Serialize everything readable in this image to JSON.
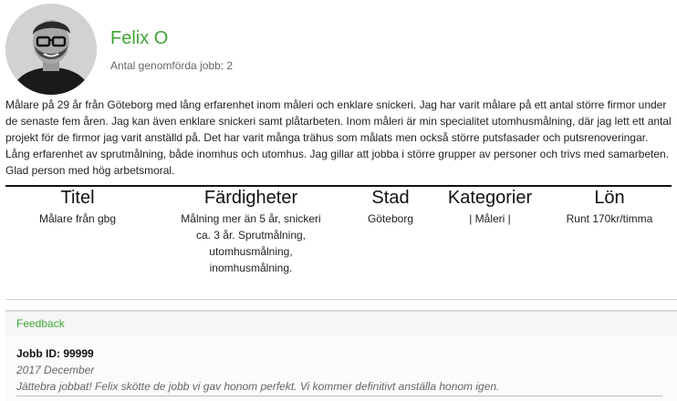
{
  "profile": {
    "name": "Felix O",
    "jobs_label": "Antal genomförda jobb: 2",
    "bio": "Målare på 29 år från Göteborg med lång erfarenhet inom måleri och enklare snickeri. Jag har varit målare på ett antal större firmor under de senaste fem åren. Jag kan även enklare snickeri samt plåtarbeten. Inom måleri är min specialitet utomhusmålning, där jag lett ett antal projekt för de firmor jag varit anställd på. Det har varit många trähus som målats men också större putsfasader och putsrenoveringar. Lång erfarenhet av sprutmålning, både inomhus och utomhus. Jag gillar att jobba i större grupper av personer och trivs med samarbeten. Glad person med hög arbetsmoral."
  },
  "table": {
    "columns": [
      {
        "header": "Titel",
        "value": "Målare från gbg"
      },
      {
        "header": "Färdigheter",
        "value": "Målning mer än 5 år, snickeri ca. 3 år. Sprutmålning, utomhusmålning, inomhusmålning."
      },
      {
        "header": "Stad",
        "value": "Göteborg"
      },
      {
        "header": "Kategorier",
        "value": "| Måleri |"
      },
      {
        "header": "Lön",
        "value": "Runt 170kr/timma"
      }
    ]
  },
  "feedback": {
    "section_label": "Feedback",
    "items": [
      {
        "job_id": "Jobb ID: 99999",
        "date": "2017 December",
        "text": "Jättebra jobbat! Felix skötte de jobb vi gav honom perfekt. Vi kommer definitivt anställa honom igen."
      }
    ]
  },
  "colors": {
    "accent": "#3fa535"
  }
}
